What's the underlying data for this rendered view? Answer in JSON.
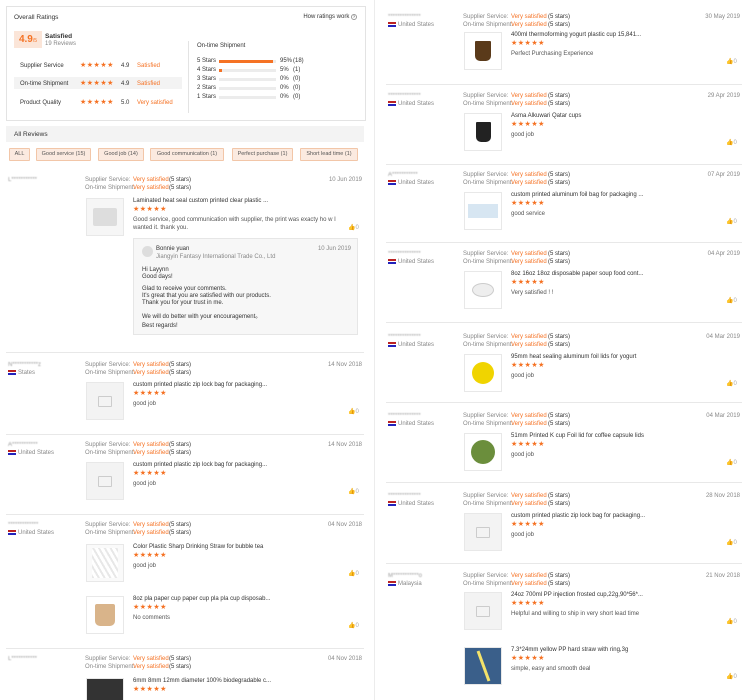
{
  "summary": {
    "title": "Overall Ratings",
    "how_link": "How ratings work",
    "score": "4.9",
    "score_max": "/5",
    "score_label": "Satisfied",
    "reviews_count": "19 Reviews",
    "metrics": [
      {
        "label": "Supplier Service",
        "value": "4.9",
        "status": "Satisfied"
      },
      {
        "label": "On-time Shipment",
        "value": "4.9",
        "status": "Satisfied"
      },
      {
        "label": "Product Quality",
        "value": "5.0",
        "status": "Very satisfied"
      }
    ],
    "shipment_title": "On-time Shipment",
    "dist": [
      {
        "label": "5 Stars",
        "pct": "95%",
        "count": "(18)",
        "fill": 0.95
      },
      {
        "label": "4 Stars",
        "pct": "5%",
        "count": "(1)",
        "fill": 0.05
      },
      {
        "label": "3 Stars",
        "pct": "0%",
        "count": "(0)",
        "fill": 0
      },
      {
        "label": "2 Stars",
        "pct": "0%",
        "count": "(0)",
        "fill": 0
      },
      {
        "label": "1 Stars",
        "pct": "0%",
        "count": "(0)",
        "fill": 0
      }
    ]
  },
  "all_reviews": "All Reviews",
  "filters": [
    "ALL",
    "Good service (15)",
    "Good job (14)",
    "Good communication (1)",
    "Perfect purchase (1)",
    "Short lead time (1)"
  ],
  "labels": {
    "supplier_service": "Supplier Service:",
    "ontime": "On-time Shipment:",
    "very_satisfied": "Very satisfied",
    "five_stars": "(5 stars)",
    "stars": "★★★★★",
    "like": "0",
    "like_icon": "👍"
  },
  "left_reviews": [
    {
      "name": "L***********",
      "country": "",
      "date": "10 Jun 2019",
      "product": "Laminated heat seal custom printed clear plastic ...",
      "comment": "Good service, good communication with supplier, the print was exacty ho w I wanted it. thank you."
    },
    {
      "name": "N***********z",
      "country": "States",
      "date": "14 Nov 2018",
      "product": "custom printed plastic zip lock bag for packaging...",
      "comment": "good job"
    },
    {
      "name": "A***********",
      "country": "United States",
      "date": "14 Nov 2018",
      "product": "custom printed plastic zip lock bag for packaging...",
      "comment": "good job"
    },
    {
      "name": "*************",
      "country": "United States",
      "date": "04 Nov 2018",
      "product": "Color Plastic Sharp Drinking Straw for bubble tea",
      "comment": "good job"
    },
    {
      "name": "",
      "country": "",
      "date": "",
      "product": "8oz pla paper cup paper cup pla pla cup disposab...",
      "comment": "No comments"
    },
    {
      "name": "L***********",
      "country": "",
      "date": "04 Nov 2018",
      "product": "6mm 8mm 12mm diameter 100% biodegradable c...",
      "comment": ""
    }
  ],
  "reply": {
    "name": "Bonnie yuan",
    "company": "Jiangyin Fantasy International Trade Co., Ltd",
    "date": "10 Jun 2019",
    "lines": [
      "Hi Layynn",
      "Good days!",
      "Glad to receive your comments.",
      "It's great that you are satisfied with our products.",
      "Thank you for your trust in me.",
      "We will do better with your encouragement。",
      "Best regards!"
    ]
  },
  "right_reviews": [
    {
      "name": "**************",
      "country": "United States",
      "date": "30 May 2019",
      "product": "400ml thermoforming yogurt plastic cup 15,841...",
      "comment": "Perfect Purchasing Experience"
    },
    {
      "name": "**************",
      "country": "United States",
      "date": "29 Apr 2019",
      "product": "Asma Alkuwari Qatar cups",
      "comment": "good job"
    },
    {
      "name": "A***********",
      "country": "United States",
      "date": "07 Apr 2019",
      "product": "custom printed aluminum foil bag for packaging ...",
      "comment": "good service"
    },
    {
      "name": "**************",
      "country": "United States",
      "date": "04 Apr 2019",
      "product": "8oz 16oz 18oz disposable paper soup food cont...",
      "comment": "Very satisfied !  !"
    },
    {
      "name": "**************",
      "country": "United States",
      "date": "04 Mar 2019",
      "product": "95mm heat sealing aluminum foil lids for yogurt",
      "comment": "good job"
    },
    {
      "name": "**************",
      "country": "United States",
      "date": "04 Mar 2019",
      "product": "51mm Printed K cup Foil lid for coffee capsule lids",
      "comment": "good job"
    },
    {
      "name": "**************",
      "country": "United States",
      "date": "28 Nov 2018",
      "product": "custom printed plastic zip lock bag for packaging...",
      "comment": "good job"
    },
    {
      "name": "M***********o",
      "country": "Malaysia",
      "date": "21 Nov 2018",
      "product": "24oz 700ml PP injection frosted cup,22g,90*56*...",
      "comment": "Helpful and willing to ship in very short lead time"
    },
    {
      "name": "",
      "country": "",
      "date": "",
      "product": "7.3*24mm yellow PP hard straw with ring,3g",
      "comment": "simple, easy and smooth deal"
    }
  ],
  "colors": {
    "accent": "#f57224",
    "chip_bg": "#fbeae0"
  }
}
